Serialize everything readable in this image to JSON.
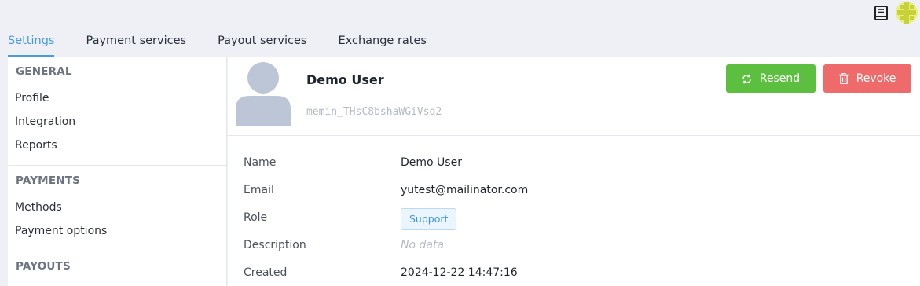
{
  "colors": {
    "accent": "#4a9cd8",
    "resend": "#5dbf3f",
    "revoke": "#ef6b6b",
    "badge_bg": "#eaf5fd",
    "badge_text": "#3e96d6"
  },
  "topbar": {
    "icons": [
      "book-icon",
      "profile-avatar-icon"
    ]
  },
  "tabs": [
    {
      "label": "Settings",
      "active": true
    },
    {
      "label": "Payment services",
      "active": false
    },
    {
      "label": "Payout services",
      "active": false
    },
    {
      "label": "Exchange rates",
      "active": false
    }
  ],
  "sidebar": {
    "sections": [
      {
        "title": "GENERAL",
        "items": [
          "Profile",
          "Integration",
          "Reports"
        ]
      },
      {
        "title": "PAYMENTS",
        "items": [
          "Methods",
          "Payment options"
        ]
      },
      {
        "title": "PAYOUTS",
        "items": []
      }
    ]
  },
  "user": {
    "name": "Demo User",
    "id": "memin_THsC8bshaWGiVsq2",
    "avatar_icon": "user-silhouette-icon"
  },
  "actions": {
    "resend_label": "Resend",
    "resend_icon": "refresh-icon",
    "revoke_label": "Revoke",
    "revoke_icon": "trash-icon"
  },
  "details": {
    "name_label": "Name",
    "name_value": "Demo User",
    "email_label": "Email",
    "email_value": "yutest@mailinator.com",
    "role_label": "Role",
    "role_value": "Support",
    "description_label": "Description",
    "description_value": "No data",
    "created_label": "Created",
    "created_value": "2024-12-22 14:47:16"
  }
}
